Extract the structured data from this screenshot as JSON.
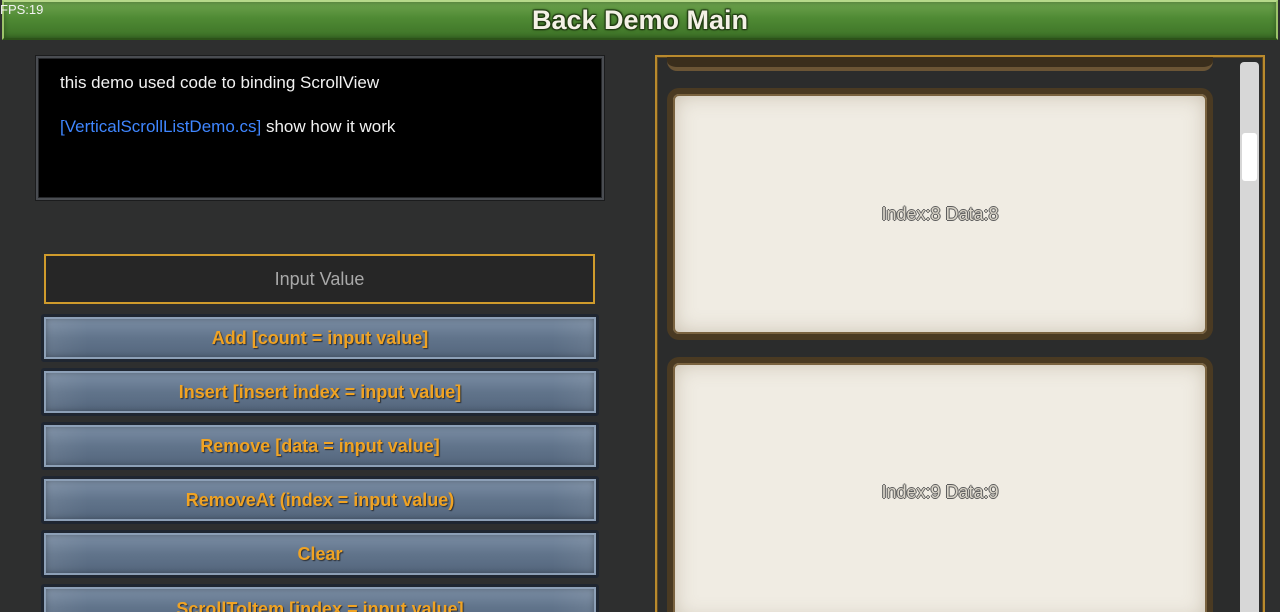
{
  "header": {
    "title": "Back Demo Main",
    "fps": "FPS:19"
  },
  "info": {
    "line1": "this demo used code to binding ScrollView",
    "link": "[VerticalScrollListDemo.cs]",
    "line2_rest": " show how it work"
  },
  "input": {
    "placeholder": "Input Value",
    "value": ""
  },
  "buttons": {
    "add": "Add [count = input value]",
    "insert": "Insert [insert index = input value]",
    "remove": "Remove [data  = input value]",
    "remove_at": "RemoveAt (index = input value)",
    "clear": "Clear",
    "scroll_to_item": "ScrollToItem [index = input value]"
  },
  "scroll_list": {
    "items": [
      {
        "label": "Index:8 Data:8"
      },
      {
        "label": "Index:9 Data:9"
      }
    ]
  },
  "colors": {
    "header_green": "#4f8a34",
    "button_text": "#f0a323",
    "link_blue": "#3f86ff",
    "panel_border_gold": "#b98a2d",
    "card_bg": "#f0ece3"
  }
}
